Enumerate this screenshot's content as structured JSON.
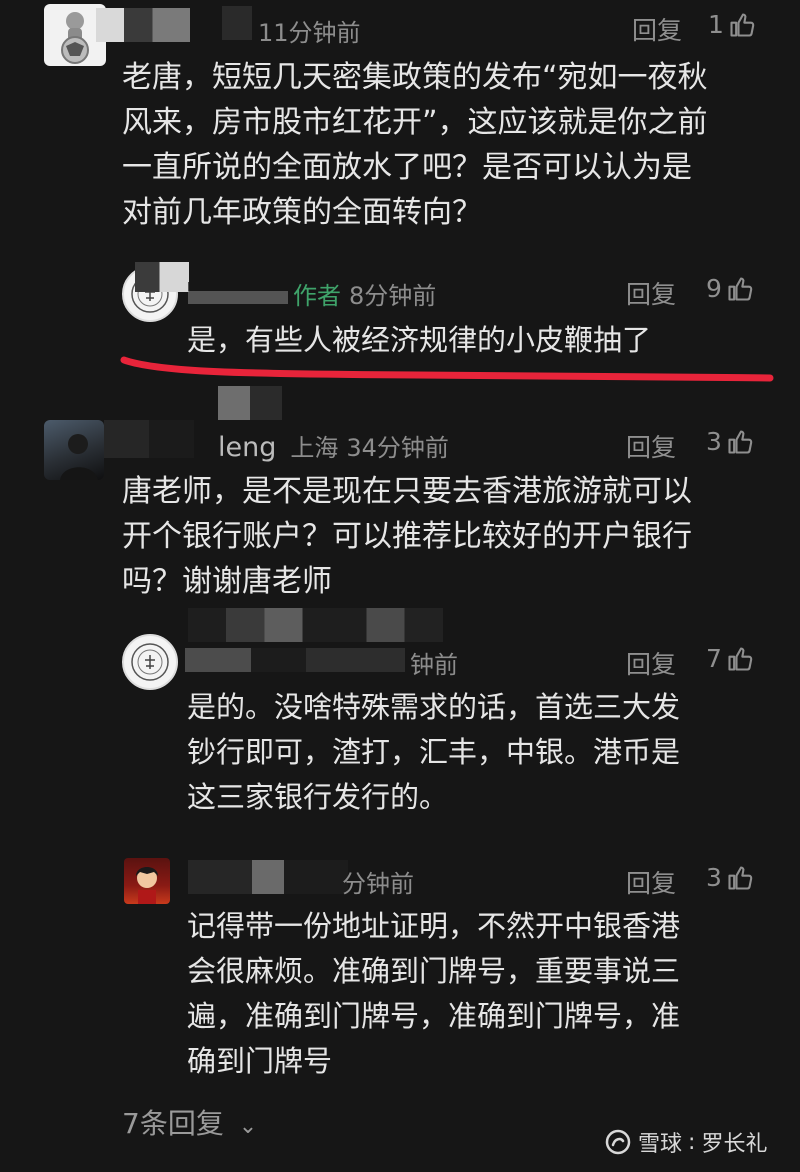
{
  "comments": [
    {
      "time": "11分钟前",
      "reply_label": "回复",
      "likes": "1",
      "text_lines": [
        "老唐，短短几天密集政策的发布“宛如一夜秋",
        "风来，房市股市红花开”，这应该就是你之前",
        "一直所说的全面放水了吧？是否可以认为是",
        "对前几年政策的全面转向？"
      ]
    },
    {
      "author_tag": "作者",
      "time": "8分钟前",
      "reply_label": "回复",
      "likes": "9",
      "text": "是，有些人被经济规律的小皮鞭抽了"
    },
    {
      "name_fragment": "leng",
      "location": "上海",
      "time": "34分钟前",
      "reply_label": "回复",
      "likes": "3",
      "text_lines": [
        "唐老师，是不是现在只要去香港旅游就可以",
        "开个银行账户？可以推荐比较好的开户银行",
        "吗？谢谢唐老师"
      ]
    },
    {
      "time": "钟前",
      "reply_label": "回复",
      "likes": "7",
      "text_lines": [
        "是的。没啥特殊需求的话，首选三大发",
        "钞行即可，渣打，汇丰，中银。港币是",
        "这三家银行发行的。"
      ]
    },
    {
      "time": "分钟前",
      "reply_label": "回复",
      "likes": "3",
      "text_lines": [
        "记得带一份地址证明，不然开中银香港",
        "会很麻烦。准确到门牌号，重要事说三",
        "遍，准确到门牌号，准确到门牌号，准",
        "确到门牌号"
      ]
    }
  ],
  "more_replies": "7条回复",
  "watermark": {
    "brand": "雪球",
    "author": "罗长礼"
  },
  "colors": {
    "background": "#161616",
    "annotation": "#e8243a",
    "author_tag": "#3fa36a"
  }
}
